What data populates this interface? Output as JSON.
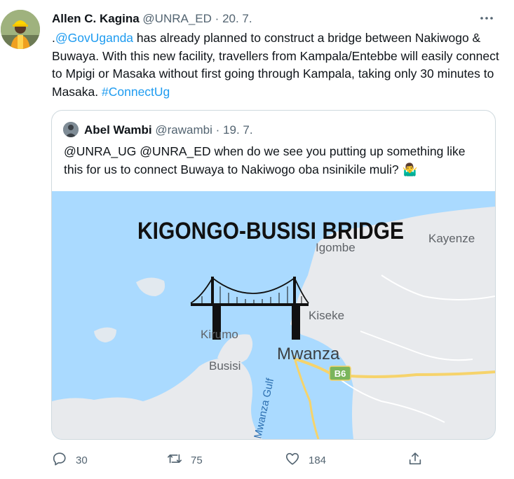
{
  "tweet": {
    "author_name": "Allen C. Kagina",
    "author_handle": "@UNRA_ED",
    "separator": "·",
    "date": "20. 7.",
    "text_prefix": ".",
    "mention": "@GovUganda",
    "text_main": " has already planned to construct a bridge between Nakiwogo & Buwaya. With this new facility, travellers from Kampala/Entebbe will easily connect to Mpigi or Masaka without first going through Kampala, taking only 30 minutes to Masaka. ",
    "hashtag": "#ConnectUg"
  },
  "quote": {
    "author_name": "Abel Wambi",
    "author_handle": "@rawambi",
    "separator": "·",
    "date": "19. 7.",
    "text": "@UNRA_UG @UNRA_ED  when do we see you putting up something like this for us to connect Buwaya to Nakiwogo oba nsinikile muli? 🤷‍♂️",
    "image": {
      "title": "KIGONGO-BUSISI BRIDGE",
      "labels": {
        "igombe": "Igombe",
        "kayenze": "Kayenze",
        "kiseke": "Kiseke",
        "kirumo": "Kirumo",
        "mwanza": "Mwanza",
        "busisi": "Busisi",
        "road_shield": "B6",
        "gulf": "Mwanza Gulf"
      }
    }
  },
  "actions": {
    "reply_count": "30",
    "retweet_count": "75",
    "like_count": "184"
  },
  "icons": {
    "more": "more-icon",
    "reply": "reply-icon",
    "retweet": "retweet-icon",
    "like": "like-icon",
    "share": "share-icon"
  },
  "colors": {
    "link": "#1d9bf0",
    "secondary_text": "#536471",
    "water": "#aadaff",
    "land": "#e8eaed",
    "road": "#f6d36b",
    "shield": "#7ab55c"
  }
}
